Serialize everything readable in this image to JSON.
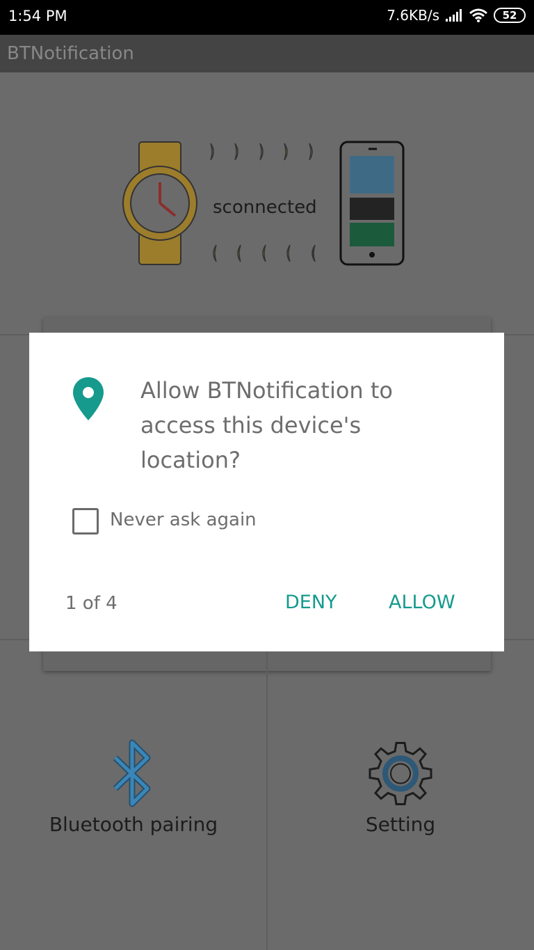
{
  "status_bar": {
    "time": "1:54 PM",
    "net_speed": "7.6KB/s",
    "battery": "52"
  },
  "app_bar": {
    "title": "BTNotification"
  },
  "hero": {
    "status_text": "sconnected",
    "colors": {
      "watch": "#caa13a",
      "phone_top": "#5aa5d6",
      "phone_mid": "#333333",
      "phone_bottom": "#1d8c56",
      "accent_blue": "#1c5aa0"
    }
  },
  "tiles": [
    {
      "label": "Bluetooth pairing",
      "icon": "bluetooth-icon"
    },
    {
      "label": "Setting",
      "icon": "gear-icon"
    }
  ],
  "dialog": {
    "message": "Allow BTNotification to access this device's location?",
    "checkbox_label": "Never ask again",
    "checkbox_checked": false,
    "counter": "1 of 4",
    "deny_label": "DENY",
    "allow_label": "ALLOW",
    "accent_color": "#159a8d",
    "icon": "location-pin-icon"
  }
}
